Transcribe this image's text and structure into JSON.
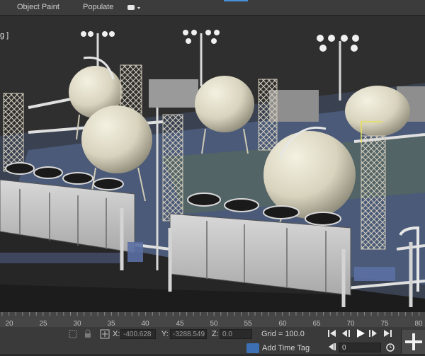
{
  "ribbon": {
    "tabs": [
      {
        "label": "Object Paint"
      },
      {
        "label": "Populate"
      }
    ],
    "dropdown_icon": "teapot-icon"
  },
  "viewport": {
    "label": "g ]"
  },
  "timeline": {
    "ticks": [
      "20",
      "25",
      "30",
      "35",
      "40",
      "45",
      "50",
      "55",
      "60",
      "65",
      "70",
      "75",
      "80"
    ]
  },
  "status": {
    "x_label": "X:",
    "x_value": "-400.628",
    "y_label": "Y:",
    "y_value": "-3288.549",
    "z_label": "Z:",
    "z_value": "0.0",
    "grid_label": "Grid = 100.0",
    "add_time_tag": "Add Time Tag",
    "frame_value": "0"
  },
  "colors": {
    "accent": "#4a90d9",
    "sphere": "#e3dfcc",
    "ground": "#4a5a75"
  }
}
